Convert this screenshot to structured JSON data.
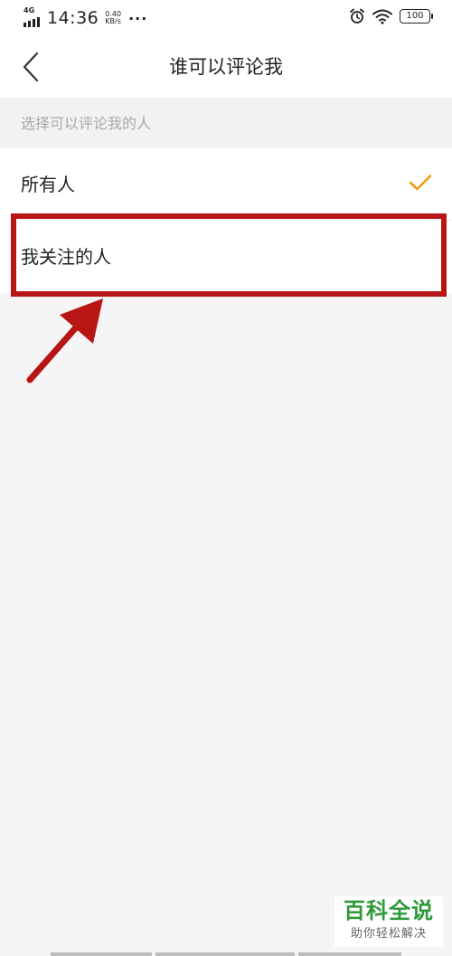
{
  "status_bar": {
    "network": "4G",
    "time": "14:36",
    "speed_value": "0.40",
    "speed_unit": "KB/s",
    "more": "···",
    "battery": "100"
  },
  "nav": {
    "title": "谁可以评论我"
  },
  "section": {
    "header": "选择可以评论我的人"
  },
  "options": [
    {
      "label": "所有人",
      "selected": true
    },
    {
      "label": "我关注的人",
      "selected": false
    }
  ],
  "colors": {
    "accent_check": "#f39c12",
    "annotation_red": "#b81515",
    "watermark_green": "#2d9a3a"
  },
  "watermark": {
    "title": "百科全说",
    "subtitle": "助你轻松解决"
  }
}
